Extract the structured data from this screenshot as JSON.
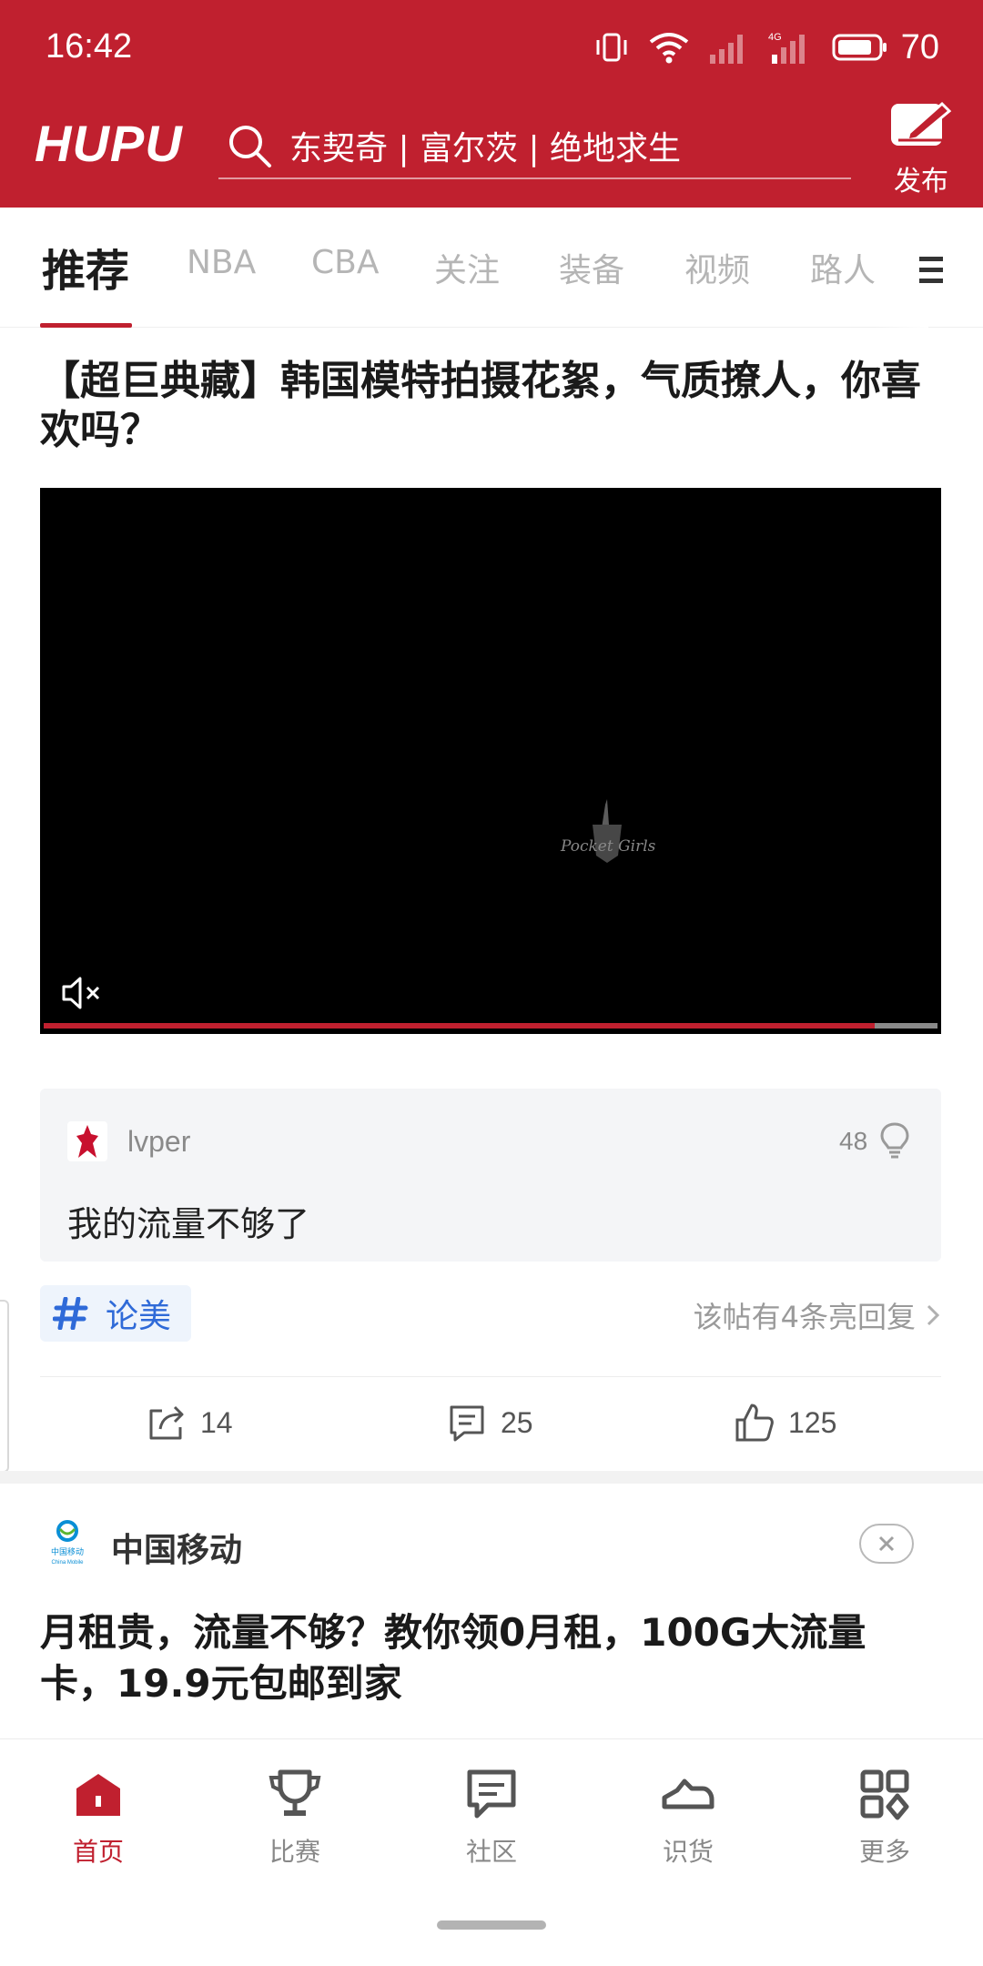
{
  "status_bar": {
    "time": "16:42",
    "battery": "70",
    "network": "4G"
  },
  "header": {
    "logo": "HUPU",
    "search_text": "东契奇 | 富尔茨 | 绝地求生",
    "publish_label": "发布"
  },
  "tabs": [
    "推荐",
    "NBA",
    "CBA",
    "关注",
    "装备",
    "视频",
    "路人"
  ],
  "active_tab": "推荐",
  "post": {
    "title": "【超巨典藏】韩国模特拍摄花絮，气质撩人，你喜欢吗？",
    "video": {
      "watermark": "Pocket Girls",
      "progress": 0.93,
      "muted": true
    },
    "top_comment": {
      "user": "lvper",
      "likes": "48",
      "text": "我的流量不够了"
    },
    "topic": "论美",
    "reply_info": "该帖有4条亮回复",
    "share_count": "14",
    "comment_count": "25",
    "like_count": "125"
  },
  "ad": {
    "advertiser": "中国移动",
    "advertiser_logo_text": "中国移动 China Mobile",
    "title": "月租贵，流量不够？教你领0月租，100G大流量卡，19.9元包邮到家"
  },
  "bottom_nav": [
    "首页",
    "比赛",
    "社区",
    "识货",
    "更多"
  ],
  "colors": {
    "brand_red": "#c0202f",
    "topic_blue": "#2f6ad8"
  }
}
